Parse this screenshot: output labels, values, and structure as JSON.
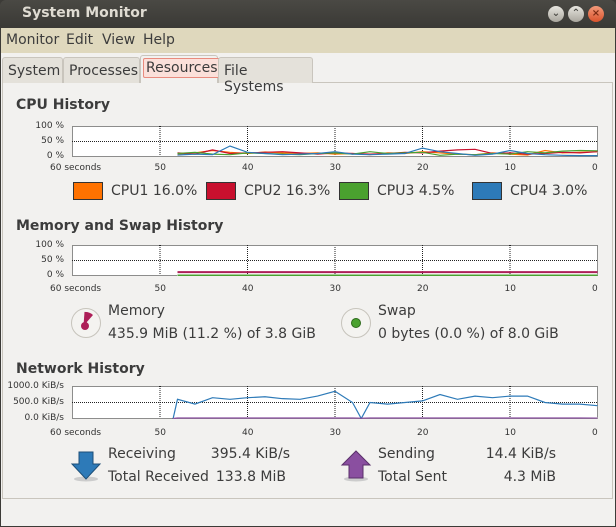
{
  "window": {
    "title": "System Monitor",
    "buttons": [
      "minimize",
      "maximize",
      "close"
    ]
  },
  "menu": [
    "Monitor",
    "Edit",
    "View",
    "Help"
  ],
  "tabs": [
    {
      "label": "System"
    },
    {
      "label": "Processes"
    },
    {
      "label": "Resources",
      "active": true
    },
    {
      "label": "File Systems"
    }
  ],
  "cpu": {
    "title": "CPU History",
    "legend": [
      {
        "label": "CPU1",
        "value": "16.0%",
        "color": "#ff7200"
      },
      {
        "label": "CPU2",
        "value": "16.3%",
        "color": "#c8102e"
      },
      {
        "label": "CPU3",
        "value": "4.5%",
        "color": "#4aa12f"
      },
      {
        "label": "CPU4",
        "value": "3.0%",
        "color": "#2d7ab8"
      }
    ]
  },
  "memory": {
    "title": "Memory and Swap History",
    "mem_label": "Memory",
    "mem_value": "435.9 MiB (11.2 %) of 3.8 GiB",
    "mem_color": "#ad1f58",
    "swap_label": "Swap",
    "swap_value": "0 bytes (0.0 %) of 8.0 GiB",
    "swap_color": "#4aa12f"
  },
  "network": {
    "title": "Network History",
    "receiving_label": "Receiving",
    "receiving_value": "395.4 KiB/s",
    "total_received_label": "Total Received",
    "total_received_value": "133.8 MiB",
    "sending_label": "Sending",
    "sending_value": "14.4 KiB/s",
    "total_sent_label": "Total Sent",
    "total_sent_value": "4.3 MiB",
    "recv_color": "#2d7ab8",
    "send_color": "#8a4fa0"
  },
  "chart_data": [
    {
      "type": "line",
      "title": "CPU History",
      "x": [
        48,
        46,
        44,
        42,
        40,
        38,
        36,
        34,
        32,
        30,
        28,
        26,
        24,
        22,
        20,
        18,
        16,
        14,
        12,
        10,
        8,
        6,
        4,
        2,
        0
      ],
      "xlim": [
        60,
        0
      ],
      "xticks": [
        "60 seconds",
        "50",
        "40",
        "30",
        "20",
        "10",
        "0"
      ],
      "yticks": [
        "100 %",
        "50 %",
        "0 %"
      ],
      "ylim": [
        0,
        100
      ],
      "grid": true,
      "series": [
        {
          "name": "CPU1",
          "color": "#ff7200",
          "values": [
            8,
            12,
            20,
            14,
            10,
            15,
            12,
            10,
            12,
            8,
            10,
            6,
            12,
            10,
            16,
            12,
            8,
            6,
            12,
            8,
            5,
            20,
            12,
            14,
            16
          ]
        },
        {
          "name": "CPU2",
          "color": "#c8102e",
          "values": [
            12,
            8,
            22,
            10,
            12,
            14,
            16,
            12,
            8,
            12,
            10,
            8,
            10,
            14,
            12,
            18,
            22,
            24,
            10,
            12,
            8,
            10,
            14,
            12,
            16
          ]
        },
        {
          "name": "CPU3",
          "color": "#4aa12f",
          "values": [
            10,
            14,
            8,
            6,
            12,
            10,
            8,
            6,
            10,
            12,
            8,
            16,
            10,
            12,
            14,
            4,
            8,
            6,
            10,
            8,
            16,
            12,
            18,
            20,
            19
          ]
        },
        {
          "name": "CPU4",
          "color": "#2d7ab8",
          "values": [
            5,
            8,
            6,
            35,
            14,
            10,
            6,
            8,
            10,
            16,
            8,
            6,
            8,
            10,
            28,
            16,
            10,
            4,
            8,
            20,
            10,
            6,
            4,
            3,
            3
          ]
        }
      ]
    },
    {
      "type": "line",
      "title": "Memory and Swap History",
      "x": [
        48,
        0
      ],
      "xlim": [
        60,
        0
      ],
      "xticks": [
        "60 seconds",
        "50",
        "40",
        "30",
        "20",
        "10",
        "0"
      ],
      "yticks": [
        "100 %",
        "50 %",
        "0 %"
      ],
      "ylim": [
        0,
        100
      ],
      "grid": true,
      "series": [
        {
          "name": "Memory",
          "color": "#ad1f58",
          "values": [
            11.2,
            11.2
          ]
        },
        {
          "name": "Swap",
          "color": "#4aa12f",
          "values": [
            0,
            0
          ]
        }
      ]
    },
    {
      "type": "line",
      "title": "Network History",
      "x": [
        48.5,
        48,
        46,
        44,
        42,
        40,
        38,
        36,
        34,
        32,
        30,
        28,
        27,
        26,
        24,
        22,
        20,
        18,
        16,
        14,
        12,
        10,
        8,
        6,
        4,
        2,
        0
      ],
      "xlim": [
        60,
        0
      ],
      "xticks": [
        "60 seconds",
        "50",
        "40",
        "30",
        "20",
        "10",
        "0"
      ],
      "yticks": [
        "1000.0 KiB/s",
        "500.0 KiB/s",
        "0.0 KiB/s"
      ],
      "ylim": [
        0,
        1000
      ],
      "grid": true,
      "series": [
        {
          "name": "Receiving",
          "color": "#2d7ab8",
          "values": [
            0,
            600,
            450,
            650,
            600,
            650,
            680,
            620,
            600,
            700,
            850,
            500,
            0,
            500,
            450,
            500,
            550,
            750,
            600,
            700,
            650,
            700,
            700,
            500,
            450,
            450,
            400
          ]
        },
        {
          "name": "Sending",
          "color": "#8a4fa0",
          "values": [
            0,
            15,
            15,
            15,
            15,
            15,
            15,
            15,
            15,
            15,
            15,
            15,
            10,
            15,
            15,
            15,
            15,
            15,
            15,
            15,
            15,
            15,
            15,
            15,
            15,
            15,
            14
          ]
        }
      ]
    }
  ]
}
